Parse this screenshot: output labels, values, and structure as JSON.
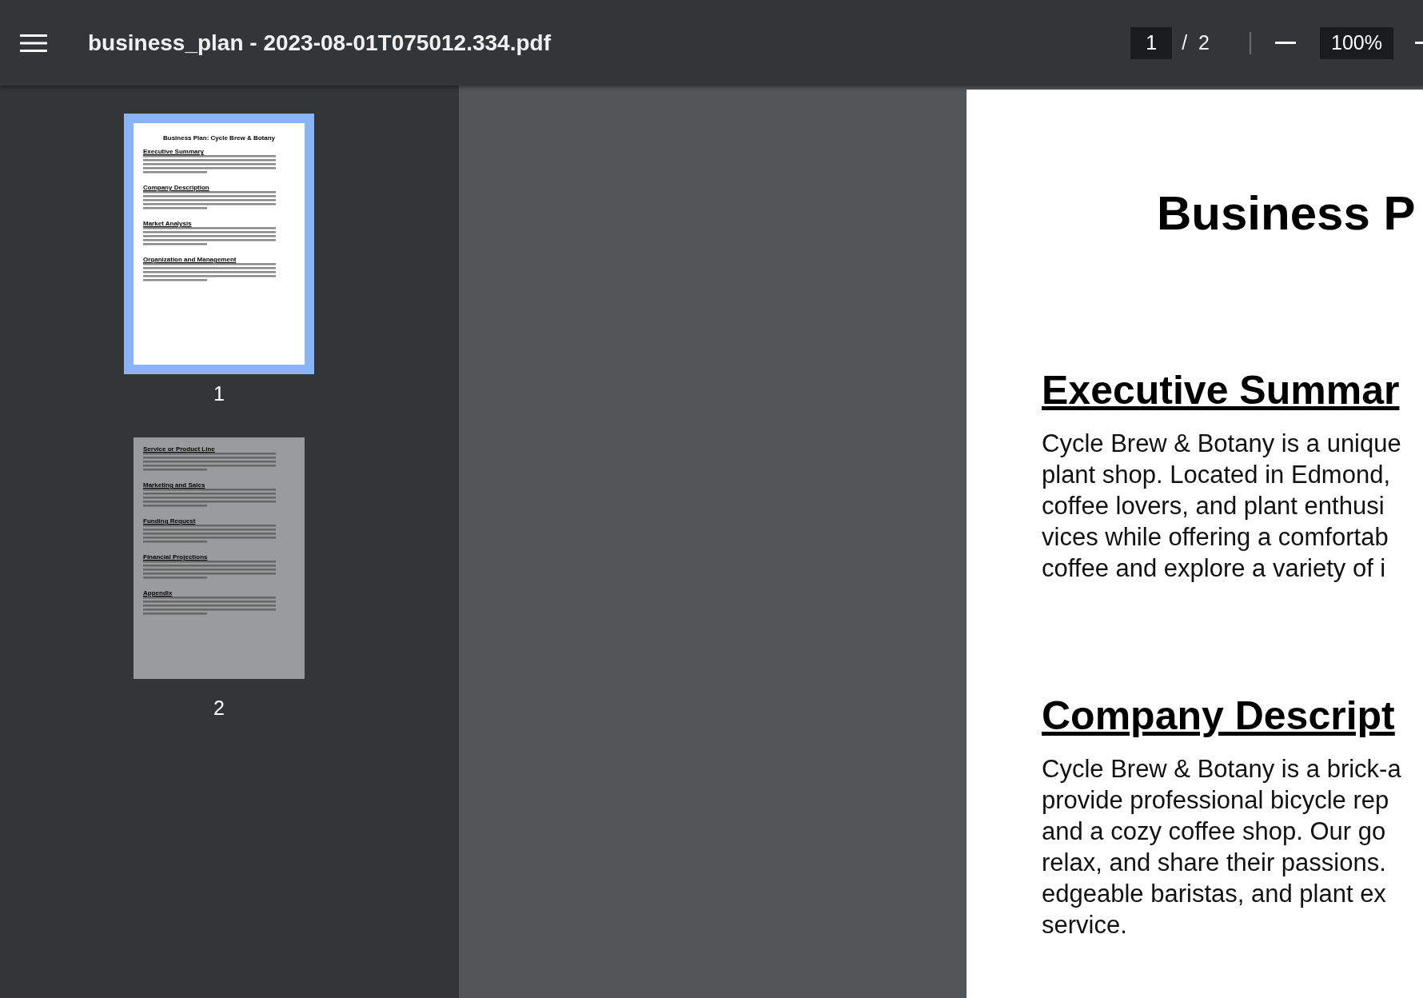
{
  "toolbar": {
    "title": "business_plan - 2023-08-01T075012.334.pdf",
    "page_input": "1",
    "page_total": "/  2",
    "zoom_input": "100%"
  },
  "thumbnails": [
    {
      "label": "1",
      "selected": true,
      "page_title": "Business Plan: Cycle Brew & Botany",
      "headings": [
        "Executive Summary",
        "Company Description",
        "Market Analysis",
        "Organization and Management"
      ]
    },
    {
      "label": "2",
      "selected": false,
      "headings": [
        "Service or Product Line",
        "Marketing and Sales",
        "Funding Request",
        "Financial Projections",
        "Appendix"
      ]
    }
  ],
  "document": {
    "title": "Business P",
    "sections": [
      {
        "heading": "Executive Summar",
        "lines": [
          "Cycle Brew & Botany is a unique",
          "plant shop. Located in Edmond,",
          "coffee lovers, and plant enthusi",
          "vices while offering a comfortab",
          "coffee and explore a variety of i"
        ]
      },
      {
        "heading": "Company Descript",
        "lines": [
          "Cycle Brew & Botany is a brick-a",
          "provide professional bicycle rep",
          "and a cozy coffee shop. Our go",
          "relax, and share their passions.",
          "edgeable baristas, and plant ex",
          "service."
        ]
      }
    ]
  }
}
